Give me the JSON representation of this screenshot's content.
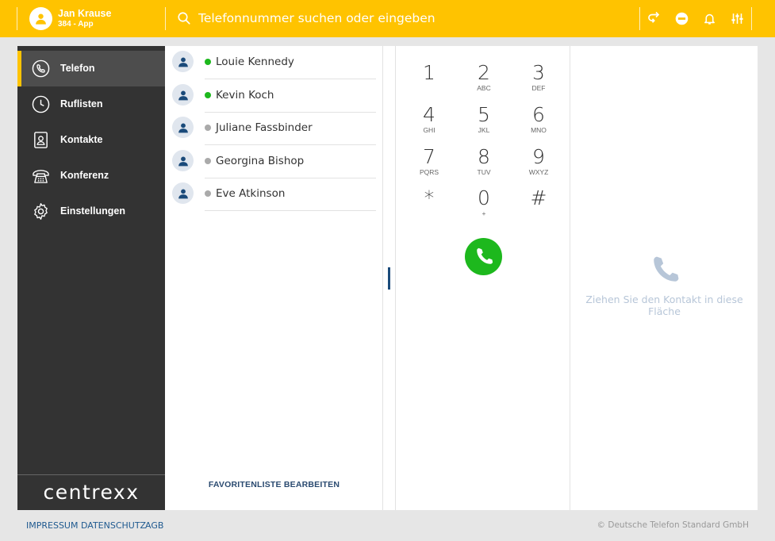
{
  "header": {
    "user_name": "Jan Krause",
    "user_sub": "384 - App",
    "search_placeholder": "Telefonnummer suchen oder eingeben",
    "accent_color": "#ffc300"
  },
  "sidebar": {
    "items": [
      {
        "label": "Telefon",
        "icon": "phone-icon",
        "active": true
      },
      {
        "label": "Ruflisten",
        "icon": "clock-icon"
      },
      {
        "label": "Kontakte",
        "icon": "contact-card-icon"
      },
      {
        "label": "Konferenz",
        "icon": "conference-phone-icon"
      },
      {
        "label": "Einstellungen",
        "icon": "gear-icon"
      }
    ],
    "logo": "centrexx"
  },
  "favorites": {
    "items": [
      {
        "name": "Louie Kennedy",
        "status": "online",
        "status_color": "#1db81d"
      },
      {
        "name": "Kevin Koch",
        "status": "online",
        "status_color": "#1db81d"
      },
      {
        "name": "Juliane Fassbinder",
        "status": "offline",
        "status_color": "#aaaaaa"
      },
      {
        "name": "Georgina Bishop",
        "status": "offline",
        "status_color": "#aaaaaa"
      },
      {
        "name": "Eve Atkinson",
        "status": "offline",
        "status_color": "#aaaaaa"
      }
    ],
    "edit_label": "FAVORITENLISTE BEARBEITEN"
  },
  "dialpad": {
    "keys": [
      {
        "digit": "1",
        "letters": ""
      },
      {
        "digit": "2",
        "letters": "ABC"
      },
      {
        "digit": "3",
        "letters": "DEF"
      },
      {
        "digit": "4",
        "letters": "GHI"
      },
      {
        "digit": "5",
        "letters": "JKL"
      },
      {
        "digit": "6",
        "letters": "MNO"
      },
      {
        "digit": "7",
        "letters": "PQRS"
      },
      {
        "digit": "8",
        "letters": "TUV"
      },
      {
        "digit": "9",
        "letters": "WXYZ"
      },
      {
        "digit": "*",
        "letters": ""
      },
      {
        "digit": "0",
        "letters": "+"
      },
      {
        "digit": "#",
        "letters": ""
      }
    ],
    "call_color": "#1db81d"
  },
  "drop_zone": {
    "text": "Ziehen Sie den Kontakt in diese Fläche"
  },
  "footer": {
    "links": [
      "IMPRESSUM",
      "DATENSCHUTZ",
      "AGB"
    ],
    "copyright": "© Deutsche Telefon Standard GmbH"
  }
}
